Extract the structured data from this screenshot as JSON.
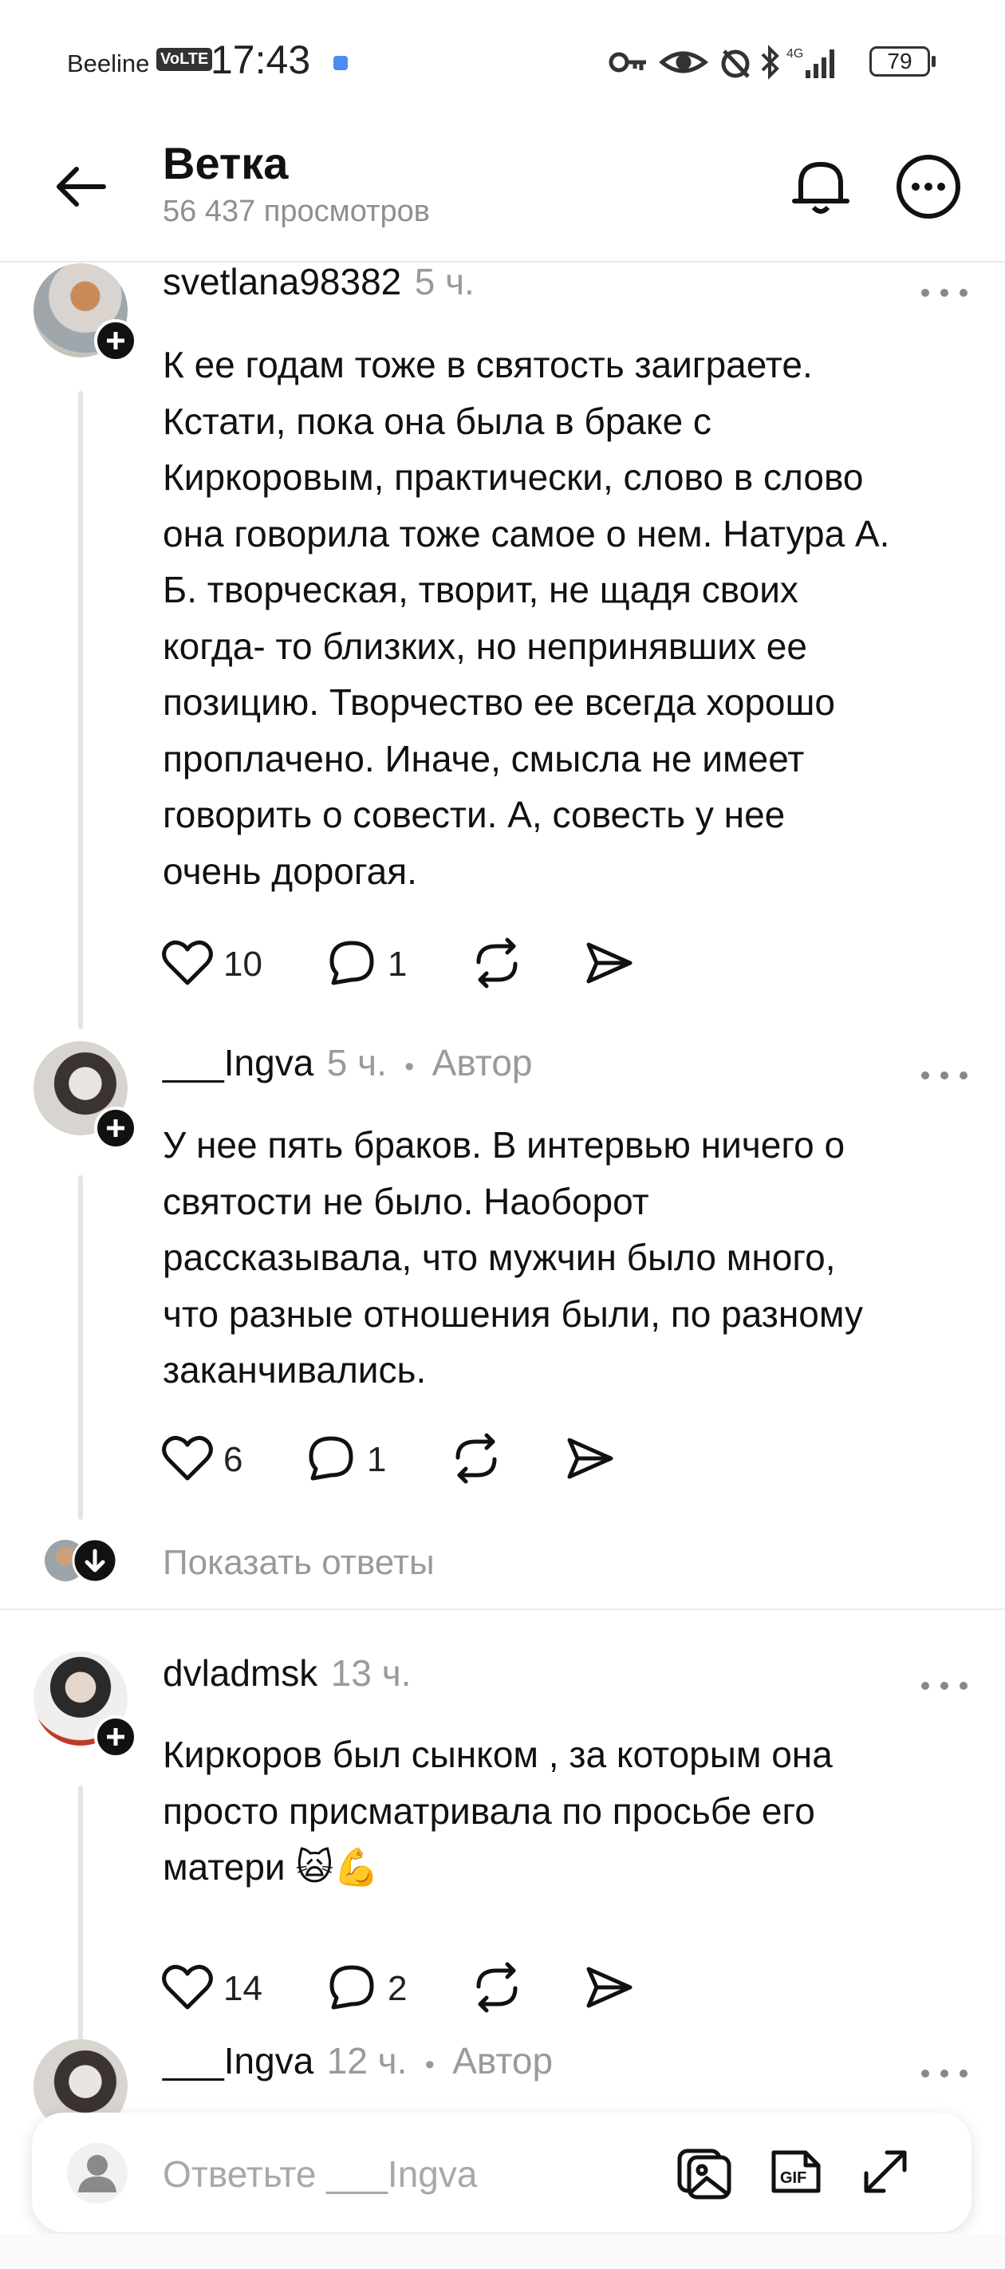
{
  "status_bar": {
    "carrier": "Beeline",
    "volte": "VoLTE",
    "time": "17:43",
    "network": "4G",
    "battery": "79"
  },
  "header": {
    "title": "Ветка",
    "views": "56 437 просмотров"
  },
  "comments": [
    {
      "username": "svetlana98382",
      "time": "5 ч.",
      "author_badge": "",
      "lines": [
        "К ее годам тоже в святость заиграете.",
        "Кстати, пока она была в браке с",
        "Киркоровым, практически, слово в слово",
        "она говорила тоже самое о нем. Натура А.",
        "Б. творческая, творит, не щадя своих",
        "когда- то близких, но непринявших ее",
        "позицию. Творчество ее всегда хорошо",
        "проплачено. Иначе, смысла не имеет",
        "говорить о совести.  А, совесть у нее",
        "очень дорогая."
      ],
      "likes": "10",
      "replies": "1"
    },
    {
      "username": "___Ingva",
      "time": "5 ч.",
      "author_badge": "Автор",
      "lines": [
        "У нее пять браков. В интервью ничего о",
        "святости не было. Наоборот",
        "рассказывала, что мужчин было много,",
        "что разные отношения были, по разному",
        "заканчивались."
      ],
      "likes": "6",
      "replies": "1"
    },
    {
      "username": "dvladmsk",
      "time": "13 ч.",
      "author_badge": "",
      "lines": [
        "Киркоров был сынком , за которым она",
        "просто присматривала по просьбе его",
        "матери 🙀💪"
      ],
      "likes": "14",
      "replies": "2"
    },
    {
      "username": "___Ingva",
      "time": "12 ч.",
      "author_badge": "Автор"
    }
  ],
  "show_replies_label": "Показать ответы",
  "separator": "•",
  "reply_box": {
    "placeholder": "Ответьте ___Ingva",
    "gif_label": "GIF"
  },
  "colors": {
    "text": "#111111",
    "muted": "#9a9a9a",
    "divider": "#e9e9e9"
  }
}
